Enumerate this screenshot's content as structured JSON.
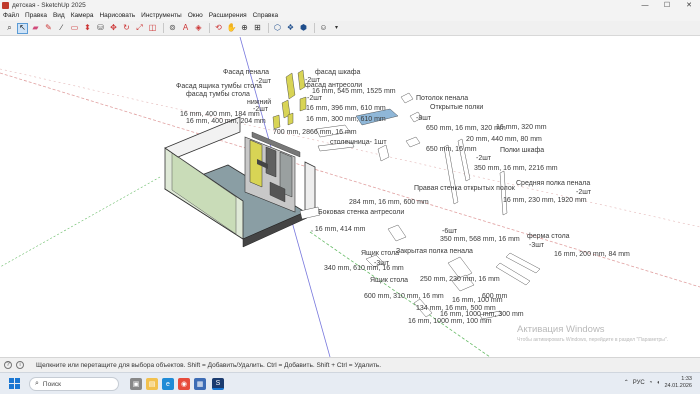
{
  "window": {
    "title": "детская - SketchUp 2025",
    "min": "—",
    "max": "☐",
    "close": "✕"
  },
  "menu": [
    "Файл",
    "Правка",
    "Вид",
    "Камера",
    "Нарисовать",
    "Инструменты",
    "Окно",
    "Расширения",
    "Справка"
  ],
  "toolbar_icons": [
    "search-icon",
    "select-arrow-icon",
    "eraser-icon",
    "pencil-icon",
    "line-icon",
    "rectangle-icon",
    "push-pull-icon",
    "paint-bucket-icon",
    "move-icon",
    "rotate-icon",
    "scale-icon",
    "offset-icon",
    "tape-measure-icon",
    "text-icon",
    "section-plane-icon",
    "orbit-icon",
    "pan-icon",
    "zoom-icon",
    "zoom-extents-icon",
    "walk-icon",
    "warehouse-icon",
    "extension-icon",
    "user-account-icon"
  ],
  "labels": [
    "Фасад пенала",
    "фасад шкафа",
    "-2шт",
    "фасад антресоли",
    "Фасад ящика тумбы стола",
    "-2шт",
    "фасад тумбы стола",
    "16 mm, 545 mm, 1525 mm",
    "нижний",
    "-2шт",
    "-2шт",
    "16 mm, 400 mm, 184 mm",
    "16 mm, 396 mm, 610 mm",
    "16 mm, 400 mm, 204 mm",
    "16 mm, 300 mm, 610 mm",
    "700 mm, 2866 mm, 16 mm",
    "столешница- 1шт",
    "Потолок пенала",
    "Открытые полки",
    "-8шт",
    "16 mm, 320 mm",
    "650 mm, 16 mm, 320 mm",
    "Полки шкафа",
    "20 mm, 440 mm, 80 mm",
    "650 mm, 16 mm",
    "-2шт",
    "350 mm, 16 mm, 2216 mm",
    "Правая стенка открытых полок",
    "Средняя полка пенала",
    "-2шт",
    "16 mm, 230 mm, 1920 mm",
    "284 mm, 16 mm, 600 mm",
    "Боковая стенка антресоли",
    "-6шт",
    "350 mm, 568 mm, 16 mm",
    ", 16 mm, 414 mm",
    "Закрытая полка пенала",
    "Ящик стола",
    "-3шт",
    "340 mm, 610 mm, 16 mm",
    "Ящик стола",
    "250 mm, 230 mm, 16 mm",
    "ферма стола",
    "-3шт",
    "16 mm, 200 mm, 84 mm",
    "600 mm, 310 mm, 16 mm",
    "134 mm, 16 mm, 500 mm",
    "16 mm, 1000 mm, 300 mm",
    "16 mm, 1000 mm, 100 mm",
    "16 mm, 100 mm",
    "600 mm"
  ],
  "activation": {
    "title": "Активация Windows",
    "body": "Чтобы активировать Windows, перейдите в раздел \"Параметры\"."
  },
  "status": {
    "hint": "Щелкните или перетащите для выбора объектов. Shift = Добавить/Удалить. Ctrl = Добавить. Shift + Ctrl = Удалить.",
    "measure_label": ""
  },
  "taskbar": {
    "search_placeholder": "Поиск",
    "lang": "РУС",
    "time": "1:33",
    "date": "24.01.2026"
  }
}
